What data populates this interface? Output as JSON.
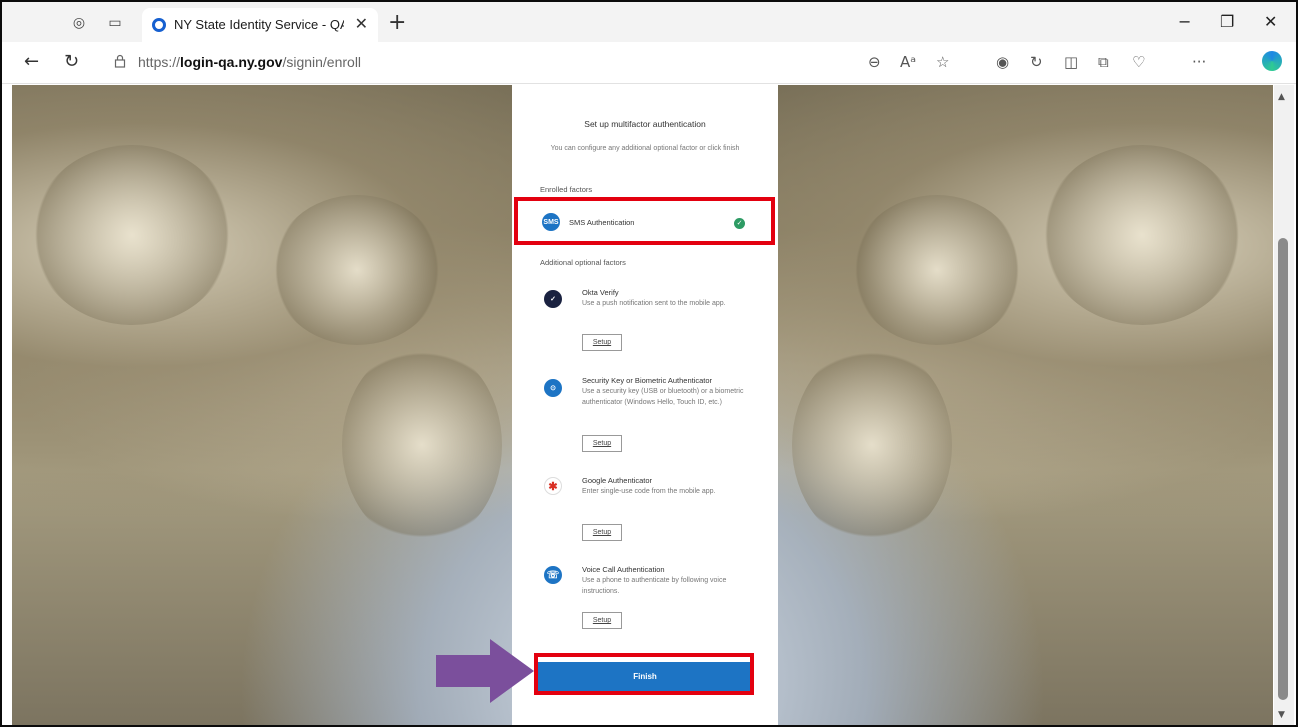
{
  "browser": {
    "tab_title": "NY State Identity Service - QA - ",
    "url_prefix": "https://",
    "url_host": "login-qa.ny.gov",
    "url_path": "/signin/enroll",
    "close_glyph": "✕",
    "new_tab_glyph": "+",
    "more_glyph": "···"
  },
  "page": {
    "title": "Set up multifactor authentication",
    "subtitle": "You can configure any additional optional factor or click finish",
    "enrolled_label": "Enrolled factors",
    "optional_label": "Additional optional factors",
    "enrolled": {
      "icon_text": "SMS",
      "name": "SMS Authentication",
      "status_icon": "check-circle-icon"
    },
    "factors": [
      {
        "name": "Okta Verify",
        "desc": "Use a push notification sent to the mobile app.",
        "setup": "Setup",
        "icon": "okta-verify-icon"
      },
      {
        "name": "Security Key or Biometric Authenticator",
        "desc": "Use a security key (USB or bluetooth) or a biometric authenticator (Windows Hello, Touch ID, etc.)",
        "setup": "Setup",
        "icon": "security-key-icon"
      },
      {
        "name": "Google Authenticator",
        "desc": "Enter single-use code from the mobile app.",
        "setup": "Setup",
        "icon": "google-authenticator-icon"
      },
      {
        "name": "Voice Call Authentication",
        "desc": "Use a phone to authenticate by following voice instructions.",
        "setup": "Setup",
        "icon": "phone-icon"
      }
    ],
    "finish_label": "Finish"
  },
  "colors": {
    "highlight": "#e3000f",
    "arrow": "#7b4f9c",
    "primary": "#1d74c4",
    "success": "#2d9b64"
  }
}
